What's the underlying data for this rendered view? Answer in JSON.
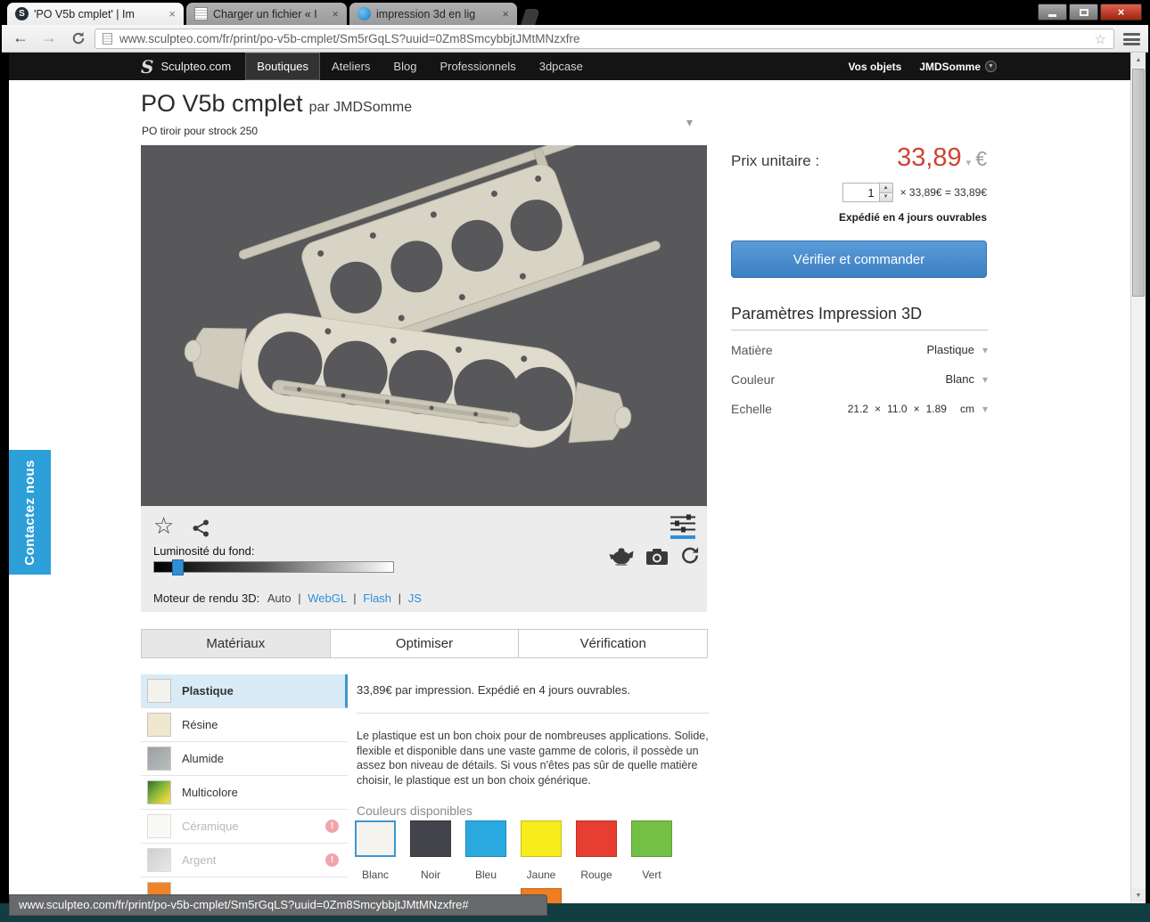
{
  "theme": {
    "accent_blue": "#3d96d2",
    "price_red": "#cd4531",
    "nav_black": "#141414",
    "viewer_bg": "#58585b"
  },
  "icons": {
    "close": "×",
    "back": "←",
    "forward": "→",
    "star": "☆",
    "chevron_down": "▾",
    "caret_up": "▲",
    "caret_down": "▼",
    "warning": "!",
    "logo_letter": "S"
  },
  "browser": {
    "tabs": [
      {
        "title": "'PO V5b cmplet' | Im"
      },
      {
        "title": "Charger un fichier « I"
      },
      {
        "title": "impression 3d en lig"
      }
    ],
    "url": "www.sculpteo.com/fr/print/po-v5b-cmplet/Sm5rGqLS?uuid=0Zm8SmcybbjtJMtMNzxfre",
    "status_text": "www.sculpteo.com/fr/print/po-v5b-cmplet/Sm5rGqLS?uuid=0Zm8SmcybbjtJMtMNzxfre#"
  },
  "navbar": {
    "brand": "Sculpteo.com",
    "items": [
      {
        "label": "Boutiques"
      },
      {
        "label": "Ateliers"
      },
      {
        "label": "Blog"
      },
      {
        "label": "Professionnels"
      },
      {
        "label": "3dpcase"
      }
    ],
    "vos_objets": "Vos objets",
    "account": "JMDSomme"
  },
  "product": {
    "title": "PO V5b cmplet",
    "author": "par JMDSomme",
    "subtitle": "PO tiroir pour strock 250"
  },
  "viewer": {
    "brightness_label": "Luminosité du fond:",
    "engine_label": "Moteur de rendu 3D:",
    "engines": [
      "Auto",
      "WebGL",
      "Flash",
      "JS"
    ],
    "separator": "|"
  },
  "pricing": {
    "label": "Prix unitaire :",
    "value": "33,89",
    "currency": "€",
    "quantity": "1",
    "calculation": "× 33,89€ = 33,89€",
    "shipping": "Expédié en 4 jours ouvrables",
    "order_button": "Vérifier et commander"
  },
  "parameters": {
    "title": "Paramètres Impression 3D",
    "material": {
      "label": "Matière",
      "value": "Plastique"
    },
    "color": {
      "label": "Couleur",
      "value": "Blanc"
    },
    "scale": {
      "label": "Echelle",
      "dims": [
        "21.2",
        "11.0",
        "1.89"
      ],
      "sep": "×",
      "unit": "cm"
    }
  },
  "tabs": [
    {
      "label": "Matériaux"
    },
    {
      "label": "Optimiser"
    },
    {
      "label": "Vérification"
    }
  ],
  "materials": [
    {
      "name": "Plastique",
      "thumb": "#f3f2ec"
    },
    {
      "name": "Résine",
      "thumb": "#efe7cf"
    },
    {
      "name": "Alumide",
      "thumb": "linear-gradient(135deg,#9aa0a2,#b9bdbe)"
    },
    {
      "name": "Multicolore",
      "thumb": "linear-gradient(135deg,#2f6e23,#86b93c 45%,#d8cf3a 75%,#e9e06a)"
    },
    {
      "name": "Céramique",
      "thumb": "#f7f6f1"
    },
    {
      "name": "Argent",
      "thumb": "linear-gradient(135deg,#aeb0b2,#d6d8da)"
    },
    {
      "name": "",
      "thumb": "#ef8328"
    }
  ],
  "detail": {
    "price_line": "33,89€ par impression. Expédié en 4 jours ouvrables.",
    "description": "Le plastique est un bon choix pour de nombreuses applications. Solide, flexible et disponible dans une vaste gamme de coloris, il possède un assez bon niveau de détails. Si vous n'êtes pas sûr de quelle matière choisir, le plastique est un bon choix générique.",
    "colors_label": "Couleurs disponibles",
    "colors": [
      {
        "name": "Blanc",
        "hex": "#f4f3ee"
      },
      {
        "name": "Noir",
        "hex": "#43434b"
      },
      {
        "name": "Bleu",
        "hex": "#29a9e0"
      },
      {
        "name": "Jaune",
        "hex": "#f7ec1c"
      },
      {
        "name": "Rouge",
        "hex": "#e63e30"
      },
      {
        "name": "Vert",
        "hex": "#74c044"
      }
    ],
    "partial_color_hex": "#ef7d22"
  },
  "contact_label": "Contactez nous"
}
